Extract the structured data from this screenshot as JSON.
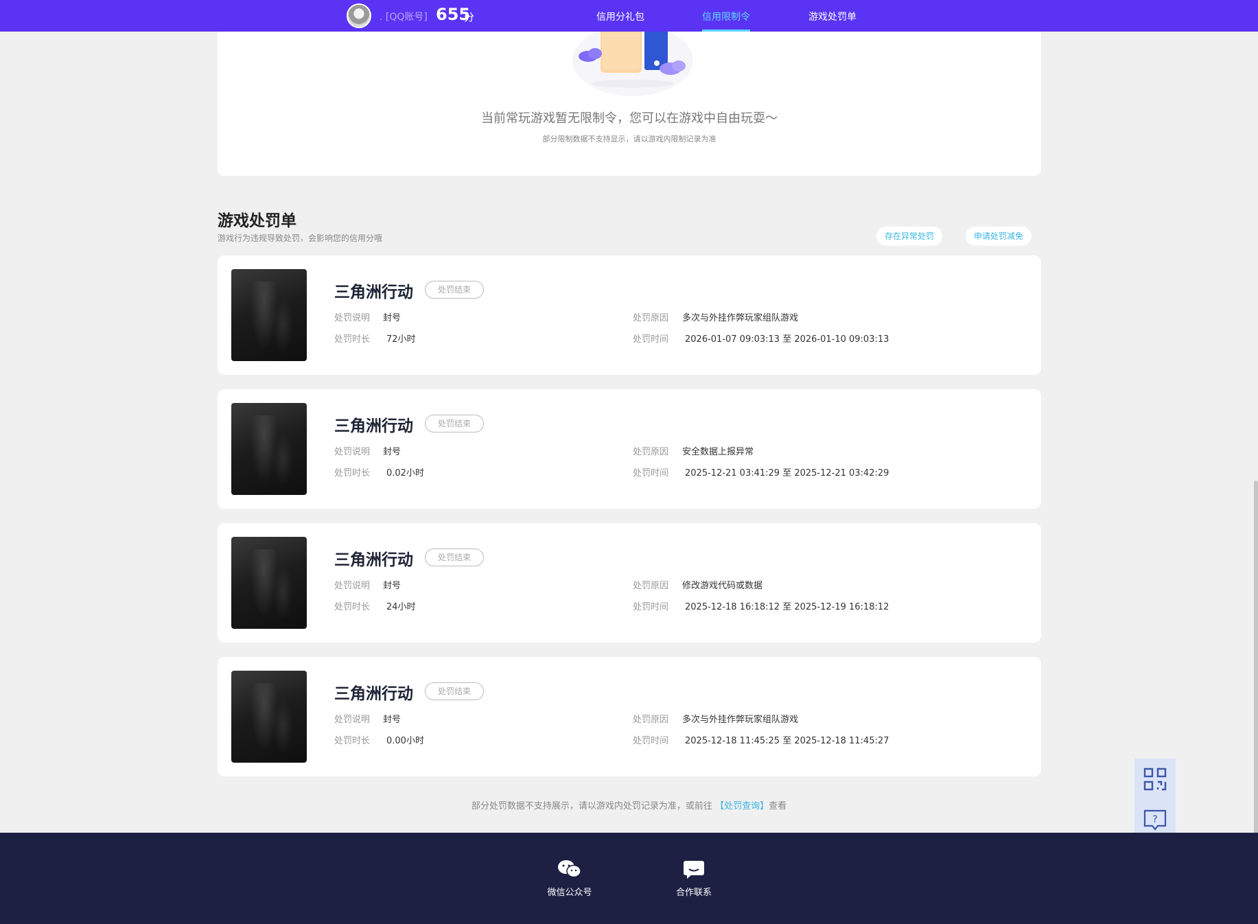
{
  "header": {
    "account_label": ". [QQ账号]",
    "score": "655",
    "score_unit": "分",
    "nav": [
      {
        "label": "信用分礼包",
        "active": false
      },
      {
        "label": "信用限制令",
        "active": true
      },
      {
        "label": "游戏处罚单",
        "active": false
      }
    ]
  },
  "limit": {
    "message": "当前常玩游戏暂无限制令，您可以在游戏中自由玩耍～",
    "note": "部分限制数据不支持显示，请以游戏内限制记录为准"
  },
  "penalty": {
    "title": "游戏处罚单",
    "subtitle": "游戏行为违规导致处罚，会影响您的信用分哦",
    "buttons": {
      "abnormal": "存在异常处罚",
      "reduce": "申请处罚减免"
    },
    "labels": {
      "desc": "处罚说明",
      "duration": "处罚时长",
      "reason": "处罚原因",
      "time": "处罚时间"
    },
    "items": [
      {
        "game": "三角洲行动",
        "status": "处罚结束",
        "desc": "封号",
        "duration": "72小时",
        "reason": "多次与外挂作弊玩家组队游戏",
        "time": "2026-01-07 09:03:13 至 2026-01-10 09:03:13"
      },
      {
        "game": "三角洲行动",
        "status": "处罚结束",
        "desc": "封号",
        "duration": "0.02小时",
        "reason": "安全数据上报异常",
        "time": "2025-12-21 03:41:29 至 2025-12-21 03:42:29"
      },
      {
        "game": "三角洲行动",
        "status": "处罚结束",
        "desc": "封号",
        "duration": "24小时",
        "reason": "修改游戏代码或数据",
        "time": "2025-12-18 16:18:12 至 2025-12-19 16:18:12"
      },
      {
        "game": "三角洲行动",
        "status": "处罚结束",
        "desc": "封号",
        "duration": "0.00小时",
        "reason": "多次与外挂作弊玩家组队游戏",
        "time": "2025-12-18 11:45:25 至 2025-12-18 11:45:27"
      }
    ],
    "footer_note_prefix": "部分处罚数据不支持展示，请以游戏内处罚记录为准，或前往",
    "footer_link": "【处罚查询】",
    "footer_note_suffix": "查看"
  },
  "footer": {
    "wechat": "微信公众号",
    "contact": "合作联系"
  },
  "colors": {
    "nav_bg": "#5a33f4",
    "accent": "#5ed5ff",
    "link": "#3bb7e6",
    "footer_bg": "#1d1f43"
  },
  "icons": [
    "avatar",
    "qr-code-icon",
    "help-chat-icon",
    "wechat-icon",
    "chat-bubble-icon"
  ]
}
